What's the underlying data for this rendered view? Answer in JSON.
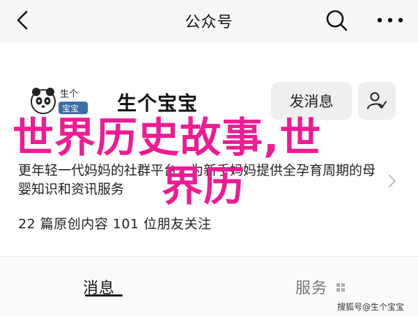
{
  "header": {
    "title": "公众号"
  },
  "account": {
    "logo_text": "生个",
    "logo_badge": "宝宝",
    "name": "生个宝宝",
    "send_message_label": "发消息",
    "description": "更年轻一代妈妈的社群平台，为新手妈妈提供全孕育周期的母婴知识和资讯服务",
    "stats": "22 篇原创内容  101 位朋友关注"
  },
  "overlay": {
    "line1": "世界历史故事,世",
    "line2": "界历"
  },
  "tabs": [
    {
      "label": "消息",
      "active": true
    },
    {
      "label": "服务",
      "active": false
    }
  ],
  "watermark": "搜狐号@生个宝宝",
  "colors": {
    "overlay": "#ee1c93",
    "bar": "#f7f7f7"
  }
}
